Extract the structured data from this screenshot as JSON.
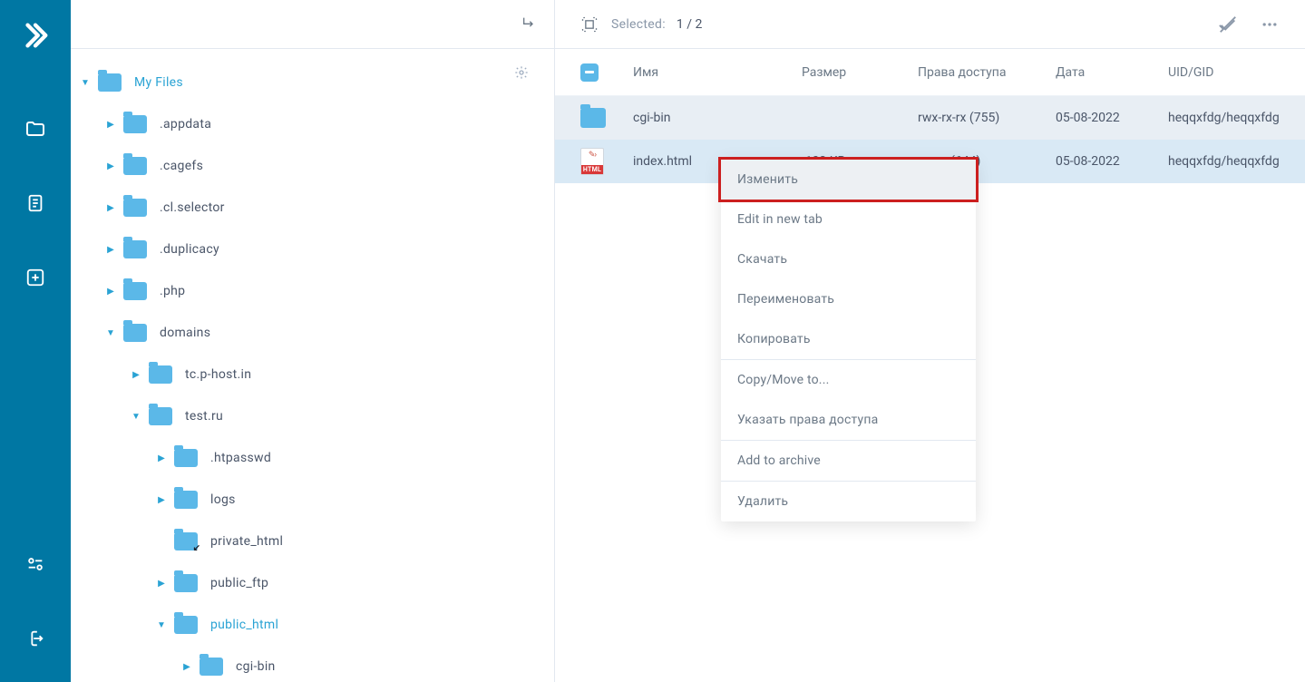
{
  "brand_color": "#0077a3",
  "accent_color": "#2aa3d4",
  "sidebar": {
    "root": "My Files",
    "items": [
      {
        "label": ".appdata",
        "depth": 1,
        "expanded": false
      },
      {
        "label": ".cagefs",
        "depth": 1,
        "expanded": false
      },
      {
        "label": ".cl.selector",
        "depth": 1,
        "expanded": false
      },
      {
        "label": ".duplicacy",
        "depth": 1,
        "expanded": false
      },
      {
        "label": ".php",
        "depth": 1,
        "expanded": false
      },
      {
        "label": "domains",
        "depth": 1,
        "expanded": true
      },
      {
        "label": "tc.p-host.in",
        "depth": 2,
        "expanded": false
      },
      {
        "label": "test.ru",
        "depth": 2,
        "expanded": true
      },
      {
        "label": ".htpasswd",
        "depth": 3,
        "expanded": false
      },
      {
        "label": "logs",
        "depth": 3,
        "expanded": false
      },
      {
        "label": "private_html",
        "depth": 3,
        "expanded": false,
        "link": true,
        "noarrow": true
      },
      {
        "label": "public_ftp",
        "depth": 3,
        "expanded": false
      },
      {
        "label": "public_html",
        "depth": 3,
        "expanded": true,
        "active": true
      },
      {
        "label": "cgi-bin",
        "depth": 4,
        "expanded": false
      }
    ]
  },
  "toolbar": {
    "selected_label": "Selected:",
    "selected_count": "1 / 2"
  },
  "table": {
    "headers": {
      "name": "Имя",
      "size": "Размер",
      "perm": "Права доступа",
      "date": "Дата",
      "uid": "UID/GID"
    },
    "rows": [
      {
        "name": "cgi-bin",
        "size": "",
        "perm": "rwx-rx-rx (755)",
        "date": "05-08-2022",
        "uid": "heqqxfdg/heqqxfdg",
        "type": "folder"
      },
      {
        "name": "index.html",
        "size": ".102 KB",
        "perm": "rw-r-r (644)",
        "date": "05-08-2022",
        "uid": "heqqxfdg/heqqxfdg",
        "type": "html",
        "selected": true
      }
    ]
  },
  "context_menu": {
    "edit": "Изменить",
    "edit_new_tab": "Edit in new tab",
    "download": "Скачать",
    "rename": "Переименовать",
    "copy": "Копировать",
    "copymove": "Copy/Move to...",
    "permissions": "Указать права доступа",
    "archive": "Add to archive",
    "delete": "Удалить"
  },
  "html_badge": "HTML"
}
